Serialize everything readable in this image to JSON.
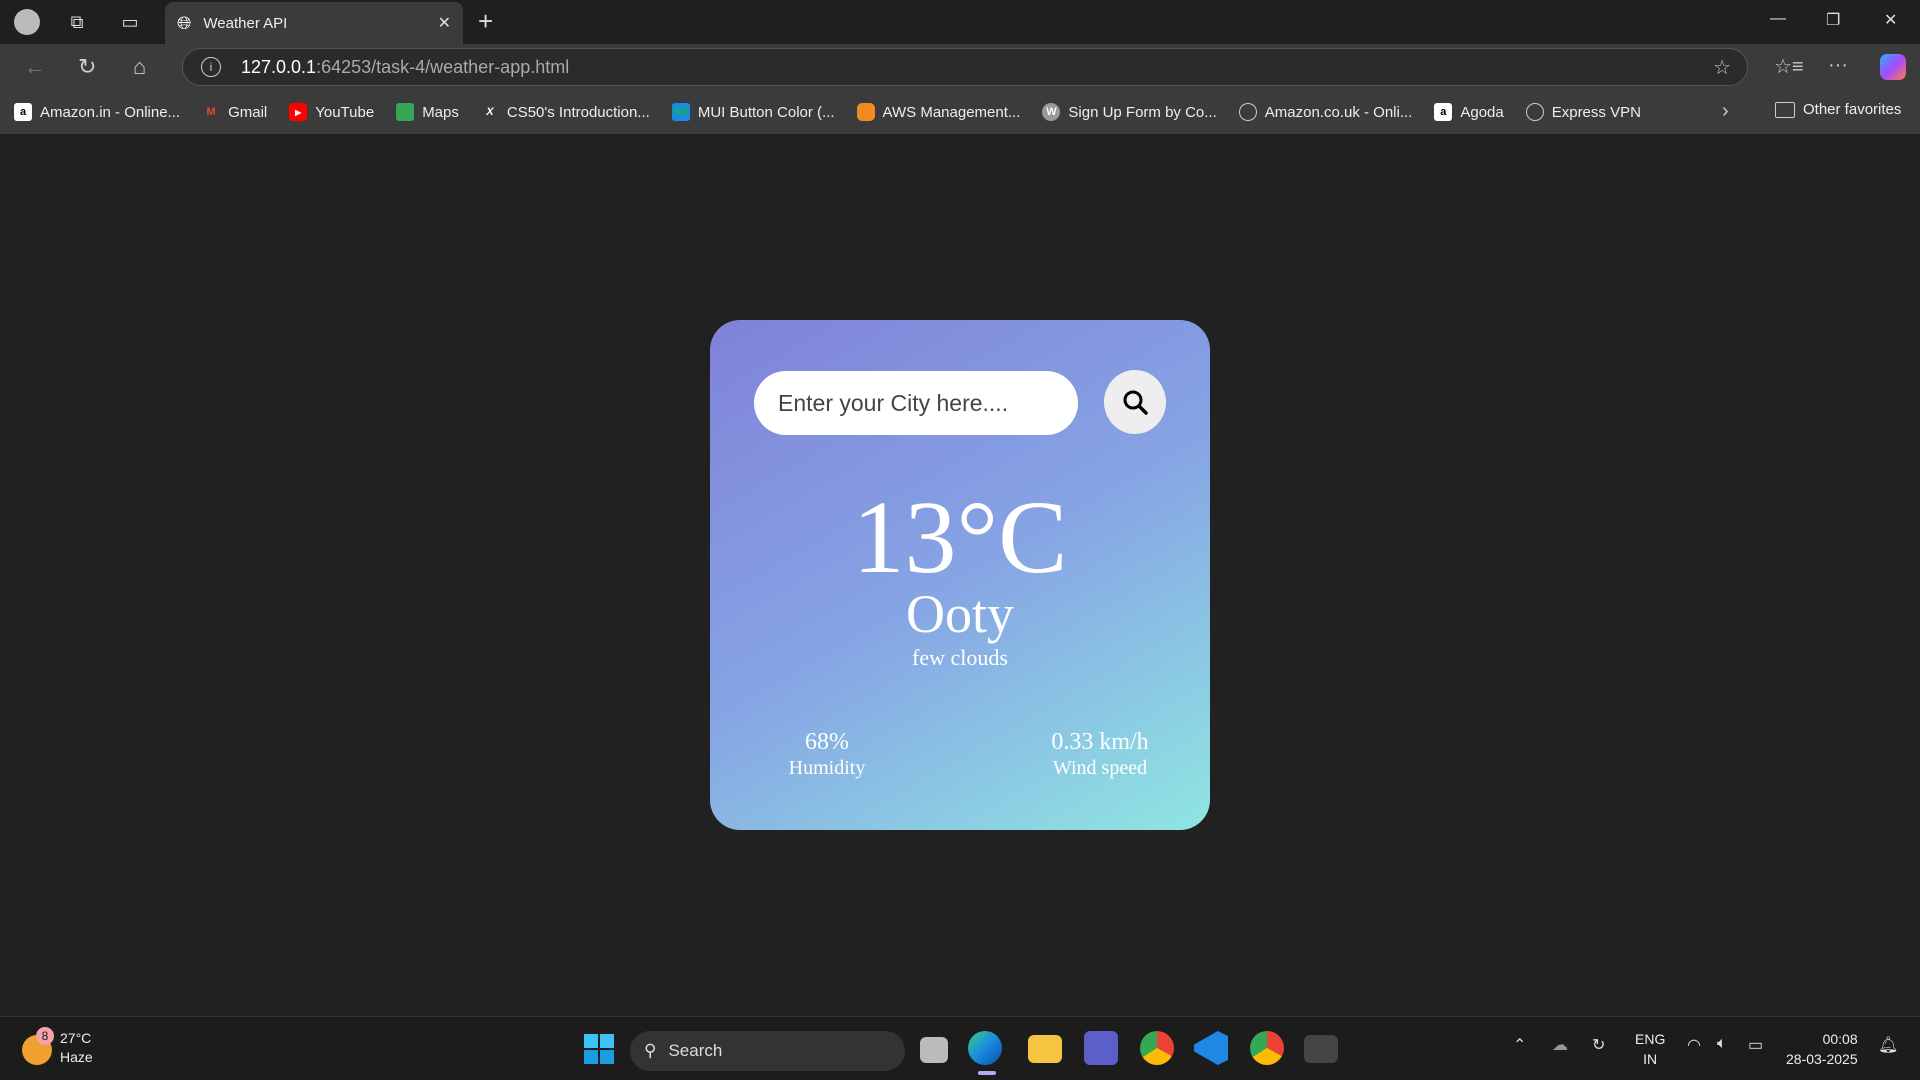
{
  "browser": {
    "tab_title": "Weather API",
    "url_host": "127.0.0.1",
    "url_rest": ":64253/task-4/weather-app.html",
    "bookmarks": [
      {
        "label": "Amazon.in - Online...",
        "icon": "amazon-icon"
      },
      {
        "label": "Gmail",
        "icon": "gmail-icon"
      },
      {
        "label": "YouTube",
        "icon": "youtube-icon"
      },
      {
        "label": "Maps",
        "icon": "maps-icon"
      },
      {
        "label": "CS50's Introduction...",
        "icon": "x-icon"
      },
      {
        "label": "MUI Button Color (...",
        "icon": "sd-icon"
      },
      {
        "label": "AWS Management...",
        "icon": "aws-icon"
      },
      {
        "label": "Sign Up Form by Co...",
        "icon": "wordpress-icon"
      },
      {
        "label": "Amazon.co.uk - Onli...",
        "icon": "globe-icon"
      },
      {
        "label": "Agoda",
        "icon": "agoda-icon"
      },
      {
        "label": "Express VPN",
        "icon": "globe-icon"
      }
    ],
    "other_favorites": "Other favorites"
  },
  "app": {
    "search_placeholder": "Enter your City here....",
    "temperature": "13°C",
    "city": "Ooty",
    "description": "few clouds",
    "humidity_value": "68%",
    "humidity_label": "Humidity",
    "wind_value": "0.33 km/h",
    "wind_label": "Wind speed",
    "colors": {
      "gradient_start": "#8082d8",
      "gradient_end": "#8fe6e2"
    }
  },
  "taskbar": {
    "weather_temp": "27°C",
    "weather_cond": "Haze",
    "weather_badge": "8",
    "search_label": "Search",
    "lang_1": "ENG",
    "lang_2": "IN",
    "time": "00:08",
    "date": "28-03-2025"
  }
}
